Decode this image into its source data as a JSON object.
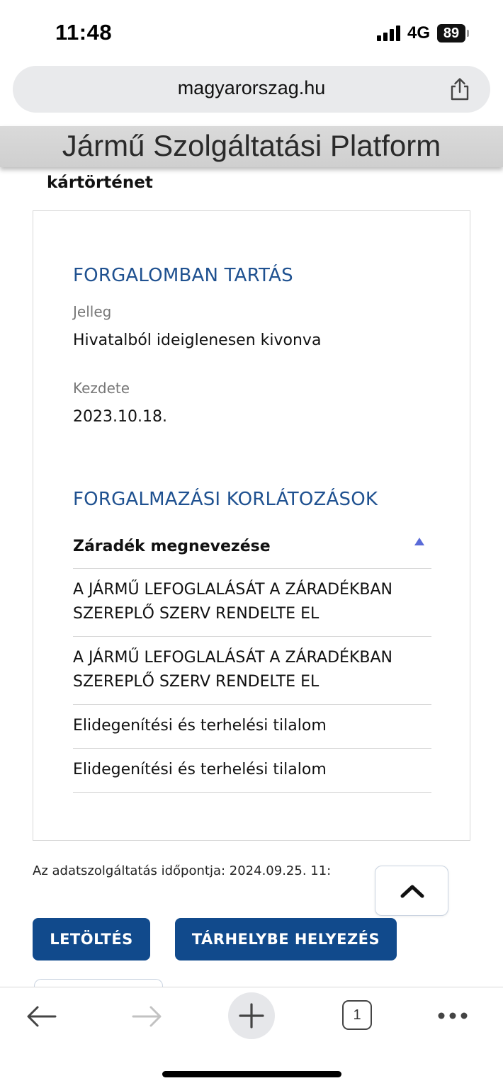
{
  "status_bar": {
    "time": "11:48",
    "network": "4G",
    "battery": "89"
  },
  "browser": {
    "url": "magyarorszag.hu",
    "share_icon": "share-icon"
  },
  "site": {
    "title": "Jármű Szolgáltatási Platform",
    "section_title": "kártörténet"
  },
  "card": {
    "traffic": {
      "heading": "FORGALOMBAN TARTÁS",
      "type_label": "Jelleg",
      "type_value": "Hivatalból ideiglenesen kivonva",
      "start_label": "Kezdete",
      "start_value": "2023.10.18."
    },
    "restrictions": {
      "heading": "FORGALMAZÁSI KORLÁTOZÁSOK",
      "column_header": "Záradék megnevezése",
      "rows": [
        "A JÁRMŰ LEFOGLALÁSÁT A ZÁRADÉKBAN SZEREPLŐ SZERV RENDELTE EL",
        "A JÁRMŰ LEFOGLALÁSÁT A ZÁRADÉKBAN SZEREPLŐ SZERV RENDELTE EL",
        "Elidegenítési és terhelési tilalom",
        "Elidegenítési és terhelési tilalom"
      ]
    }
  },
  "footer": {
    "timestamp_text": "Az adatszolgáltatás időpontja: 2024.09.25. 11:"
  },
  "buttons": {
    "download": "LETÖLTÉS",
    "storage": "TÁRHELYBE HELYEZÉS"
  },
  "toolbar": {
    "tab_count": "1"
  },
  "colors": {
    "heading_blue": "#1f5190",
    "button_blue": "#114a8c",
    "sort_arrow": "#5a6bd8"
  }
}
